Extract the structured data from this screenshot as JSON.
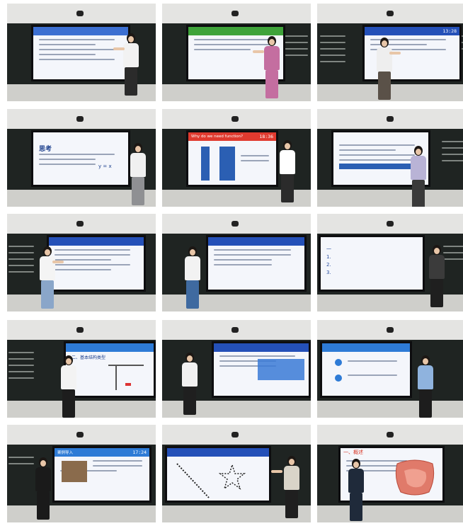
{
  "tiles": [
    {
      "id": 1,
      "header": "",
      "time": "",
      "accent": "#3c6fd1"
    },
    {
      "id": 2,
      "header": "",
      "time": "",
      "accent": "#3fa33a"
    },
    {
      "id": 3,
      "header": "",
      "time": "13:28",
      "accent": "#2450b8"
    },
    {
      "id": 4,
      "header": "思考",
      "time": "",
      "accent": "#2450b8"
    },
    {
      "id": 5,
      "header": "Why do we need function?",
      "time": "18:36",
      "accent": "#e03a2f"
    },
    {
      "id": 6,
      "header": "",
      "time": "",
      "accent": "#2450b8"
    },
    {
      "id": 7,
      "header": "",
      "time": "",
      "accent": "#2450b8"
    },
    {
      "id": 8,
      "header": "",
      "time": "",
      "accent": "#2450b8"
    },
    {
      "id": 9,
      "header": "",
      "time": "",
      "accent": "#2450b8"
    },
    {
      "id": 10,
      "header": "二、基本结构类型",
      "time": "",
      "accent": "#2e7bd6"
    },
    {
      "id": 11,
      "header": "",
      "time": "",
      "accent": "#2450b8"
    },
    {
      "id": 12,
      "header": "",
      "time": "",
      "accent": "#2e7bd6"
    },
    {
      "id": 13,
      "header": "案例导入",
      "time": "17:24",
      "accent": "#2e7bd6"
    },
    {
      "id": 14,
      "header": "",
      "time": "",
      "accent": "#2450b8"
    },
    {
      "id": 15,
      "header": "一、概述",
      "time": "",
      "accent": "#d93a2a"
    }
  ],
  "tile4_formula": "y = x",
  "tile9_lines": [
    "一",
    "1.",
    "2.",
    "3."
  ]
}
